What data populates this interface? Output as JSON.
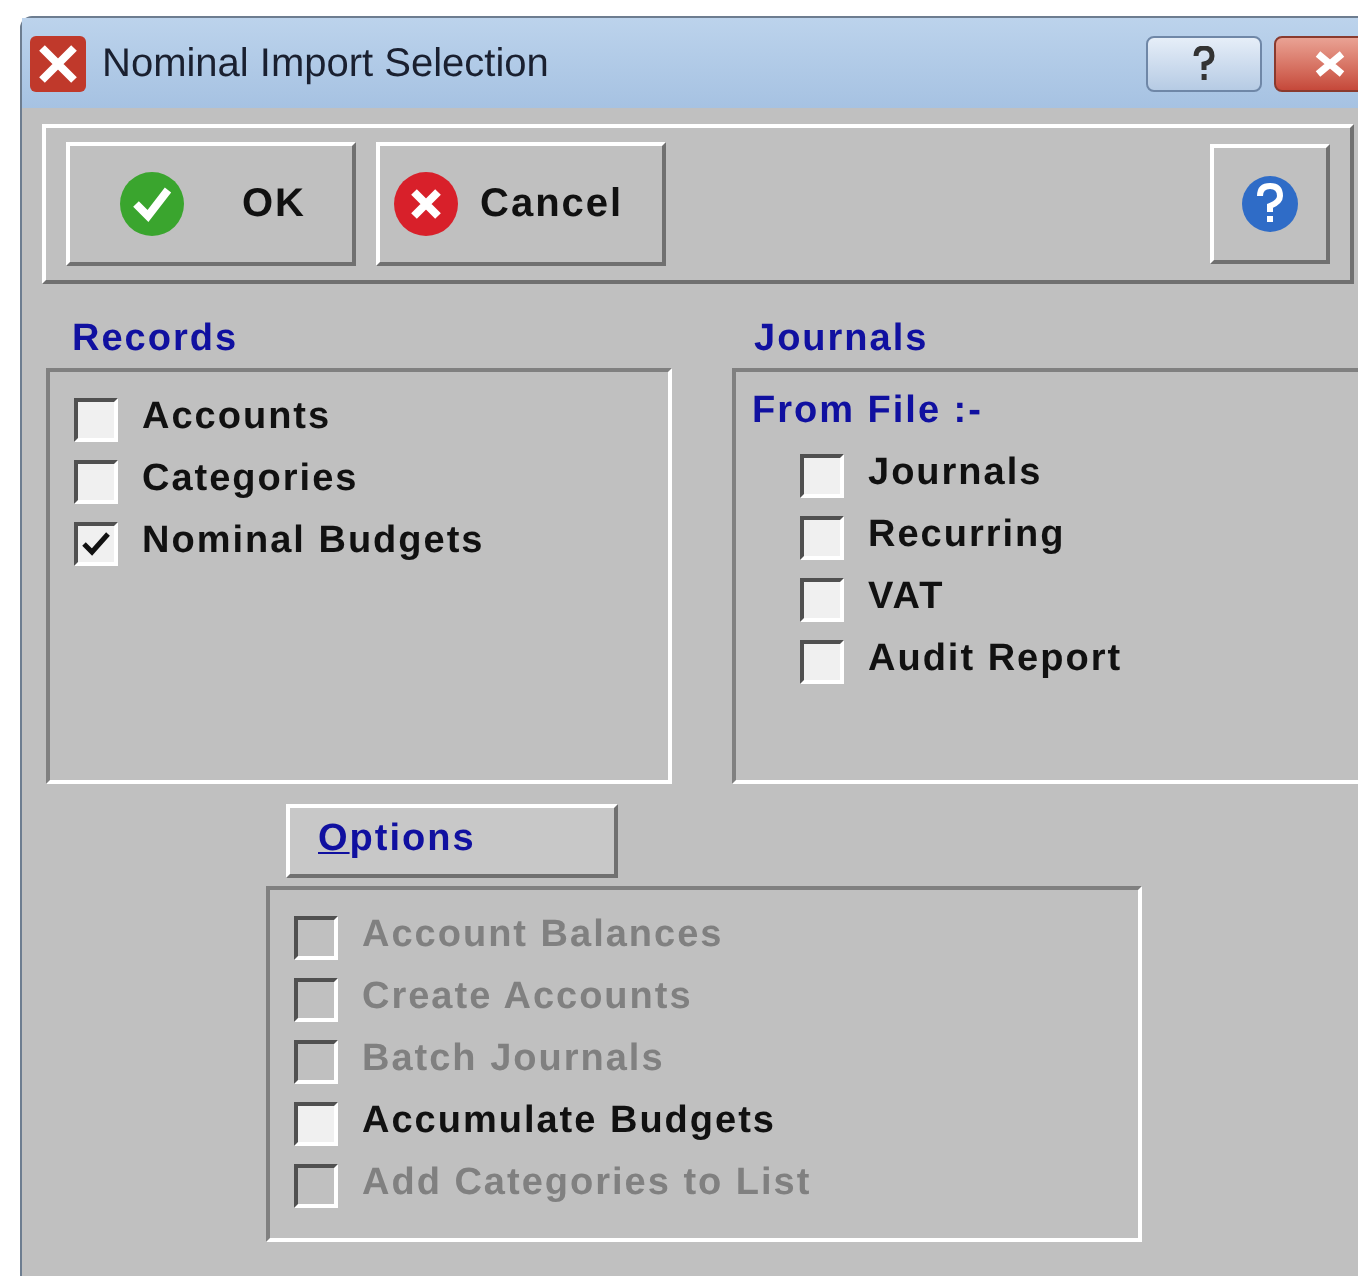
{
  "window": {
    "title": "Nominal Import Selection"
  },
  "toolbar": {
    "buttons": [
      {
        "kind": "ok",
        "label": "OK"
      },
      {
        "kind": "cancel",
        "label": "Cancel"
      }
    ]
  },
  "records": {
    "title": "Records",
    "items": [
      {
        "label": "Accounts",
        "checked": false
      },
      {
        "label": "Categories",
        "checked": false
      },
      {
        "label": "Nominal Budgets",
        "checked": true
      }
    ]
  },
  "journals": {
    "title": "Journals",
    "subtitle": "From File :-",
    "items": [
      {
        "label": "Journals",
        "checked": false
      },
      {
        "label": "Recurring",
        "checked": false
      },
      {
        "label": "VAT",
        "checked": false
      },
      {
        "label": "Audit Report",
        "checked": false
      }
    ]
  },
  "options": {
    "label": "Options",
    "items": [
      {
        "label": "Account Balances",
        "checked": false,
        "disabled": true
      },
      {
        "label": "Create Accounts",
        "checked": false,
        "disabled": true
      },
      {
        "label": "Batch Journals",
        "checked": false,
        "disabled": true
      },
      {
        "label": "Accumulate Budgets",
        "checked": false,
        "disabled": false
      },
      {
        "label": "Add Categories to List",
        "checked": false,
        "disabled": true
      }
    ]
  }
}
